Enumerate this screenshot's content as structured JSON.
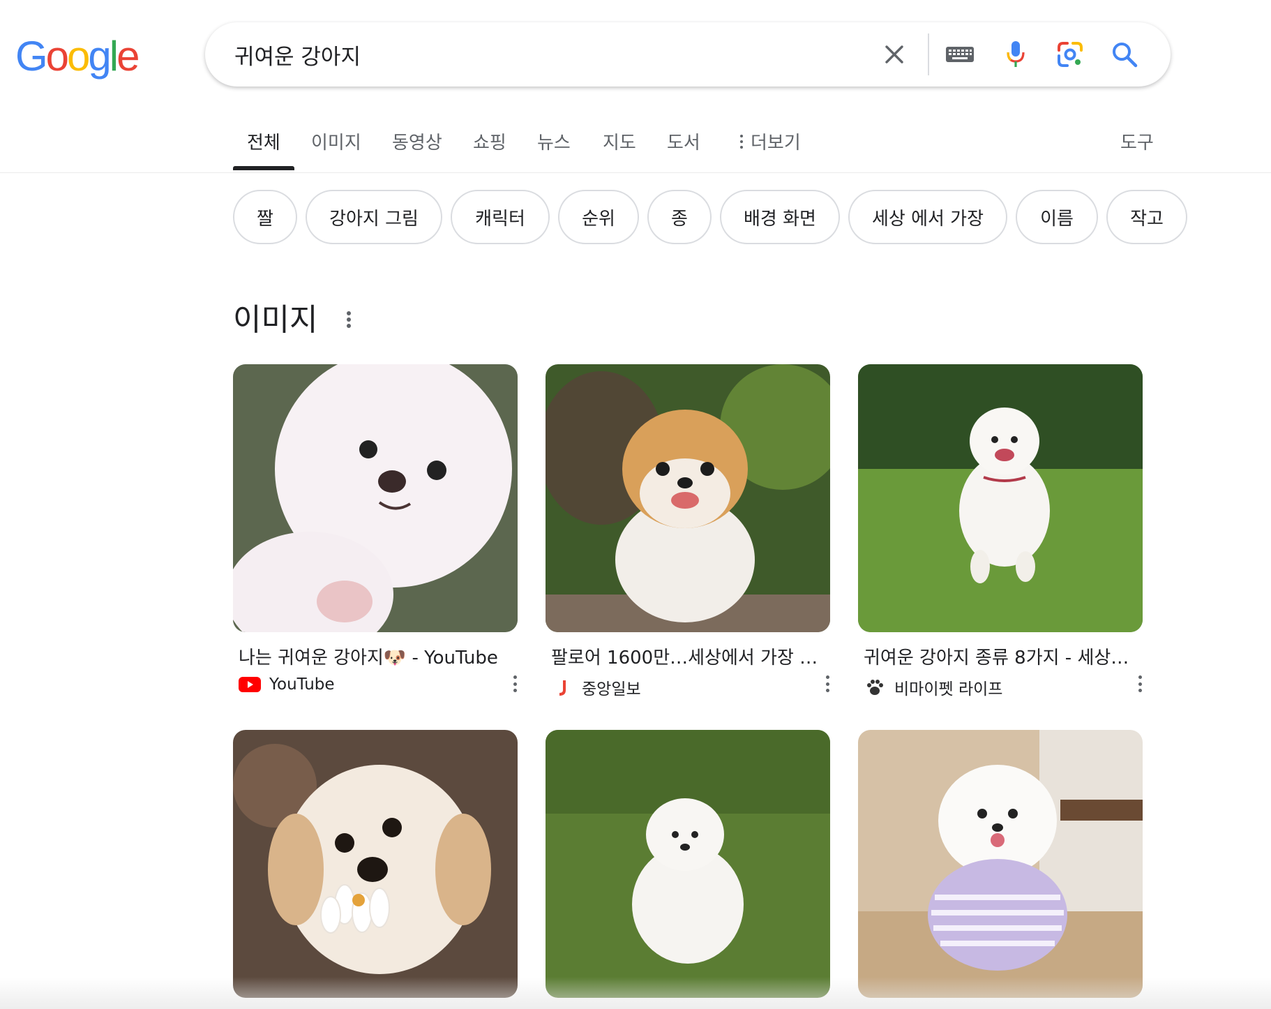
{
  "header": {
    "logo_letters": [
      "G",
      "o",
      "o",
      "g",
      "l",
      "e"
    ],
    "logo_colors": [
      "#4285F4",
      "#EA4335",
      "#FBBC05",
      "#4285F4",
      "#34A853",
      "#EA4335"
    ],
    "query": "귀여운 강아지",
    "icons": [
      "close-icon",
      "keyboard-icon",
      "microphone-icon",
      "lens-camera-icon",
      "search-icon"
    ]
  },
  "tabs": {
    "items": [
      "전체",
      "이미지",
      "동영상",
      "쇼핑",
      "뉴스",
      "지도",
      "도서"
    ],
    "more": "더보기",
    "tools": "도구",
    "active": "전체"
  },
  "chips": [
    "짤",
    "강아지 그림",
    "캐릭터",
    "순위",
    "종",
    "배경 화면",
    "세상 에서 가장",
    "이름",
    "작고"
  ],
  "images_section": {
    "title": "이미지",
    "cards": [
      {
        "title": "나는 귀여운 강아지🐶 - YouTube",
        "source": "YouTube"
      },
      {
        "title": "팔로어 1600만…세상에서 가장 …",
        "source": "중앙일보"
      },
      {
        "title": "귀여운 강아지 종류 8가지 - 세상…",
        "source": "비마이펫 라이프"
      },
      {
        "title": "",
        "source": ""
      },
      {
        "title": "",
        "source": ""
      },
      {
        "title": "",
        "source": ""
      }
    ]
  },
  "colors": {
    "google_blue": "#4285F4",
    "google_red": "#EA4335",
    "google_yellow": "#FBBC05",
    "google_green": "#34A853",
    "youtube_red": "#FF0000"
  }
}
